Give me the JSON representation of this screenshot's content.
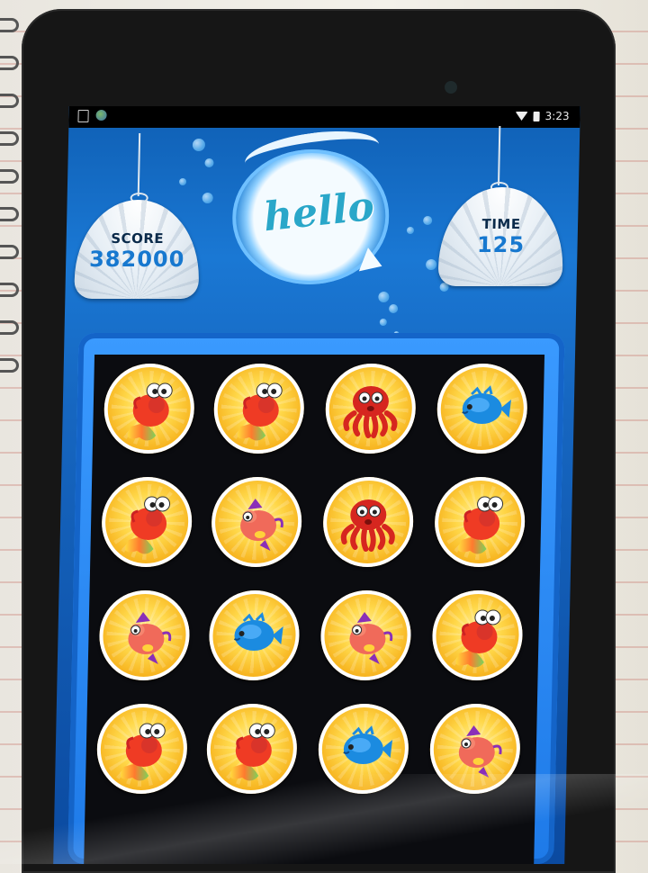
{
  "statusbar": {
    "time": "3:23",
    "icons": [
      "download-doc-icon",
      "globe-icon",
      "wifi-icon",
      "battery-icon"
    ]
  },
  "hud": {
    "score_label": "SCORE",
    "score_value": "382000",
    "time_label": "TIME",
    "time_value": "125",
    "greeting": "hello"
  },
  "colors": {
    "screen_blue": "#1666c0",
    "board_bg": "#0b0c10",
    "tile_gold": "#ffd84a",
    "label_dark": "#0a2a4a",
    "value_blue": "#1778cf",
    "hello_teal": "#2aa7c9"
  },
  "board": {
    "rows": [
      [
        "goldfish",
        "goldfish",
        "octopus",
        "pufferfish"
      ],
      [
        "goldfish",
        "pinkfish",
        "octopus",
        "goldfish"
      ],
      [
        "pinkfish",
        "pufferfish",
        "pinkfish",
        "goldfish"
      ],
      [
        "goldfish",
        "goldfish",
        "pufferfish",
        "pinkfish"
      ]
    ]
  }
}
